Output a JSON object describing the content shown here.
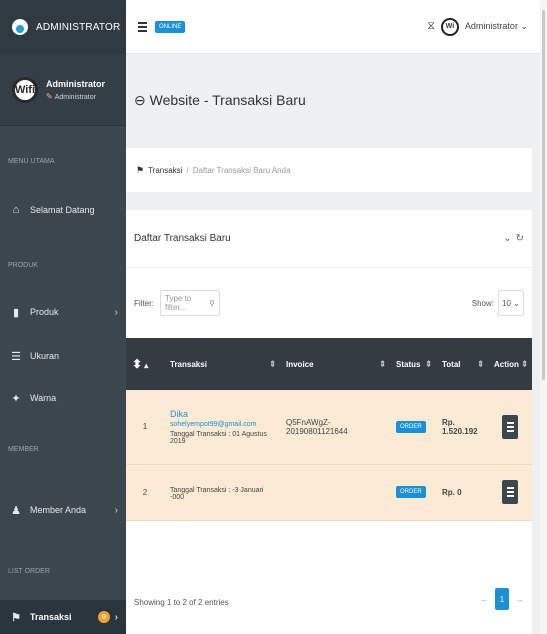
{
  "brand": {
    "label": "ADMINISTRATOR"
  },
  "profile": {
    "avatar_text": "Wifi",
    "name": "Administrator",
    "role": "Administrator"
  },
  "sidebar": {
    "sections": [
      "MENU UTAMA",
      "PRODUK",
      "MEMBER",
      "LIST ORDER"
    ],
    "items": [
      {
        "label": "Selamat Datang",
        "icon": "home-icon"
      },
      {
        "label": "Produk",
        "icon": "bottle-icon"
      },
      {
        "label": "Ukuran",
        "icon": "sliders-icon"
      },
      {
        "label": "Warna",
        "icon": "paint-icon"
      },
      {
        "label": "Member Anda",
        "icon": "user-icon"
      },
      {
        "label": "Transaksi",
        "icon": "flag-icon",
        "badge": "0"
      }
    ]
  },
  "topbar": {
    "status": "ONLINE",
    "user": "Administrator",
    "avatar_text": "Wi"
  },
  "page": {
    "title": "Website - Transaksi Baru"
  },
  "breadcrumb": {
    "root": "Transaksi",
    "separator": "/",
    "current": "Daftar Transaksi Baru Anda"
  },
  "card": {
    "title": "Daftar Transaksi Baru"
  },
  "filter": {
    "label": "Filter:",
    "placeholder": "Type to filter..."
  },
  "show": {
    "label": "Show:",
    "value": "10"
  },
  "table": {
    "headers": [
      "",
      "Transaksi",
      "Invoice",
      "Status",
      "Total",
      "Action"
    ],
    "rows": [
      {
        "no": "1",
        "name": "Dika",
        "email": "sohelyempot99@gmail.com",
        "date": "Tanggal Transaksi : 01 Agustus 2019",
        "invoice": "Q5FnAWgZ-20190801121644",
        "status": "ORDER",
        "total": "Rp. 1.520.192"
      },
      {
        "no": "2",
        "name": "",
        "email": "",
        "date": "Tanggal Transaksi : -3 Januari -000",
        "invoice": "",
        "status": "ORDER",
        "total": "Rp. 0"
      }
    ]
  },
  "footer": {
    "info": "Showing 1 to 2 of 2 entries",
    "page": "1",
    "prev": "←",
    "next": "→"
  },
  "colors": {
    "sidebar": "#3b464f",
    "accent": "#1a90d9",
    "row_bg": "#fcebd4",
    "table_head": "#343c42"
  }
}
